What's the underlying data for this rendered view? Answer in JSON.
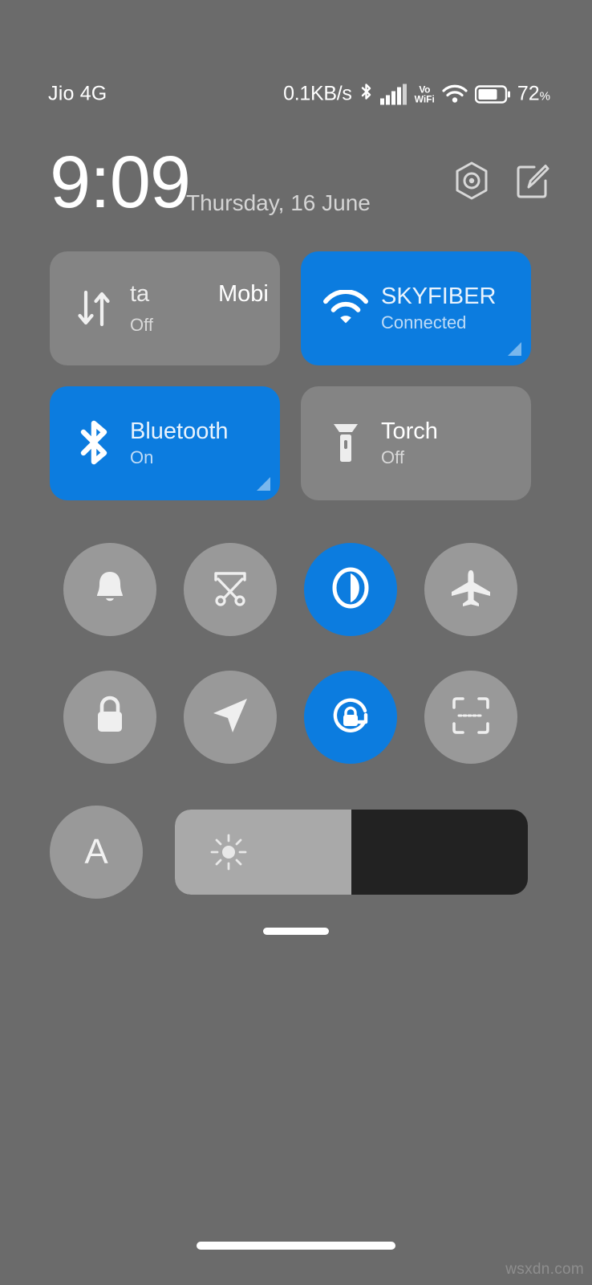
{
  "colors": {
    "background": "#6b6b6b",
    "tile_inactive": "#848484",
    "tile_active": "#0c7cdf",
    "circle_inactive": "#999999",
    "slider_track": "#222222",
    "slider_fill": "#a9a9a9",
    "text_primary": "#ffffff",
    "text_secondary": "#d9d9d9"
  },
  "status_bar": {
    "carrier": "Jio 4G",
    "network_speed": "0.1KB/s",
    "bluetooth_icon": "bluetooth-icon",
    "signal_icon": "cellular-signal-icon",
    "volte_line1": "Vo",
    "volte_line2": "WiFi",
    "wifi_icon": "wifi-icon",
    "battery_icon": "battery-icon",
    "battery_percent": "72",
    "battery_percent_symbol": "%"
  },
  "clock_row": {
    "time": "9:09",
    "date": "Thursday, 16 June",
    "settings_icon": "hex-settings-icon",
    "edit_icon": "edit-tiles-icon"
  },
  "tiles": [
    {
      "id": "mobile-data",
      "title_fragment_1": "ta",
      "title_fragment_2": "Mobi",
      "status": "Off",
      "active": false,
      "icon": "mobile-data-arrows-icon",
      "has_expand_corner": false
    },
    {
      "id": "wifi",
      "title": "SKYFIBER",
      "status": "Connected",
      "active": true,
      "icon": "wifi-icon",
      "has_expand_corner": true
    },
    {
      "id": "bluetooth",
      "title": "Bluetooth",
      "status": "On",
      "active": true,
      "icon": "bluetooth-icon",
      "has_expand_corner": true
    },
    {
      "id": "torch",
      "title": "Torch",
      "status": "Off",
      "active": false,
      "icon": "flashlight-icon",
      "has_expand_corner": false
    }
  ],
  "circle_toggles_row1": [
    {
      "id": "ringer",
      "icon": "bell-icon",
      "active": false
    },
    {
      "id": "screenshot",
      "icon": "scissors-icon",
      "active": false
    },
    {
      "id": "dark-mode",
      "icon": "contrast-icon",
      "active": true
    },
    {
      "id": "airplane",
      "icon": "airplane-icon",
      "active": false
    }
  ],
  "circle_toggles_row2": [
    {
      "id": "screen-lock",
      "icon": "lock-icon",
      "active": false
    },
    {
      "id": "location",
      "icon": "location-arrow-icon",
      "active": false
    },
    {
      "id": "auto-rotate",
      "icon": "rotation-lock-icon",
      "active": true
    },
    {
      "id": "scanner",
      "icon": "scan-frame-icon",
      "active": false
    }
  ],
  "brightness": {
    "auto_label": "A",
    "auto_active": false,
    "slider_icon": "brightness-sun-icon",
    "fill_percent": 50
  },
  "handles": {
    "panel_handle": "panel-drag-handle",
    "nav_handle": "navigation-home-handle"
  },
  "watermark": "wsxdn.com"
}
